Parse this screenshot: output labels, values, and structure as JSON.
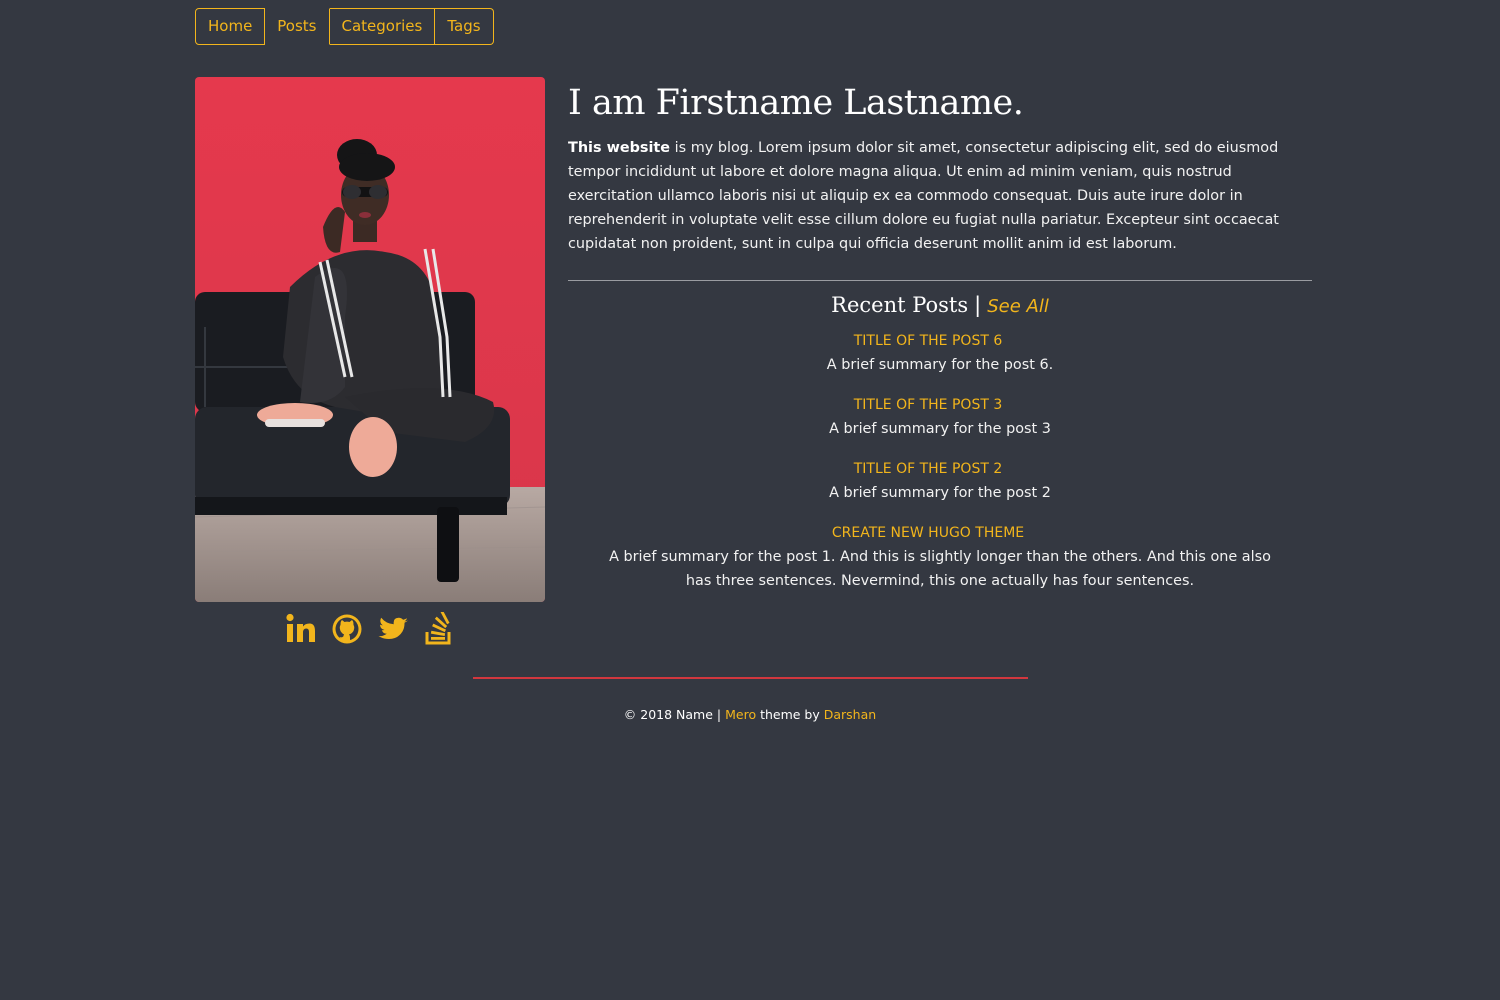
{
  "nav": {
    "items": [
      {
        "label": "Home"
      },
      {
        "label": "Posts"
      },
      {
        "label": "Categories"
      },
      {
        "label": "Tags"
      }
    ]
  },
  "profile": {
    "heading": "I am Firstname Lastname.",
    "intro_bold": "This website",
    "intro_text": " is my blog. Lorem ipsum dolor sit amet, consectetur adipiscing elit, sed do eiusmod tempor incididunt ut labore et dolore magna aliqua. Ut enim ad minim veniam, quis nostrud exercitation ullamco laboris nisi ut aliquip ex ea commodo consequat. Duis aute irure dolor in reprehenderit in voluptate velit esse cillum dolore eu fugiat nulla pariatur. Excepteur sint occaecat cupidatat non proident, sunt in culpa qui officia deserunt mollit anim id est laborum."
  },
  "social": {
    "icons": [
      "linkedin-icon",
      "github-icon",
      "twitter-icon",
      "stackoverflow-icon"
    ]
  },
  "recent": {
    "title": "Recent Posts",
    "separator": "|",
    "see_all": "See All",
    "posts": [
      {
        "title": "Title of the post 6",
        "summary": "A brief summary for the post 6."
      },
      {
        "title": "Title of the post 3",
        "summary": "A brief summary for the post 3"
      },
      {
        "title": "Title of the post 2",
        "summary": "A brief summary for the post 2"
      },
      {
        "title": "Create New Hugo Theme",
        "summary": "A brief summary for the post 1. And this is slightly longer than the others. And this one also has three sentences. Nevermind, this one actually has four sentences."
      }
    ]
  },
  "footer": {
    "copyright": "© 2018 Name",
    "separator": "|",
    "theme_name": "Mero",
    "theme_by": " theme by ",
    "author": "Darshan"
  },
  "colors": {
    "background": "#343841",
    "accent": "#f2b51c",
    "footer_line": "#d2373e"
  }
}
